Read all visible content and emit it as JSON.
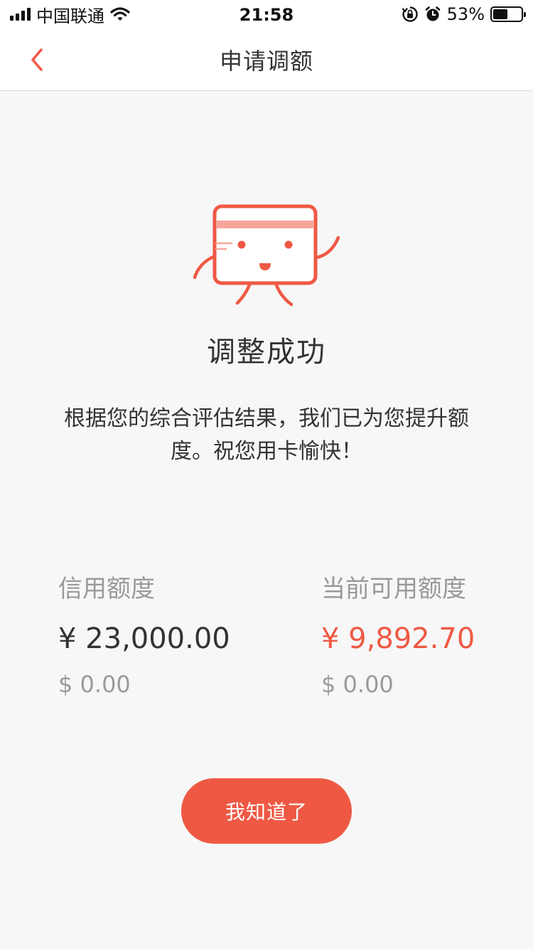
{
  "status_bar": {
    "carrier": "中国联通",
    "time": "21:58",
    "battery_percent": "53%",
    "battery_level": 0.53,
    "icons": [
      "signal-icon",
      "wifi-icon",
      "orientation-lock-icon",
      "alarm-icon",
      "battery-icon"
    ]
  },
  "nav": {
    "title": "申请调额",
    "back_icon": "chevron-left-icon"
  },
  "result": {
    "title": "调整成功",
    "description": "根据您的综合评估结果，我们已为您提升额度。祝您用卡愉快！",
    "illustration": "card-mascot-icon"
  },
  "amounts": {
    "credit_limit": {
      "label": "信用额度",
      "cny": "¥ 23,000.00",
      "usd": "$ 0.00"
    },
    "available_limit": {
      "label": "当前可用额度",
      "cny": "¥ 9,892.70",
      "usd": "$ 0.00"
    }
  },
  "confirm_button": "我知道了",
  "colors": {
    "accent": "#ef5944",
    "text_primary": "#333333",
    "text_secondary": "#999999",
    "background": "#f7f7f7"
  }
}
